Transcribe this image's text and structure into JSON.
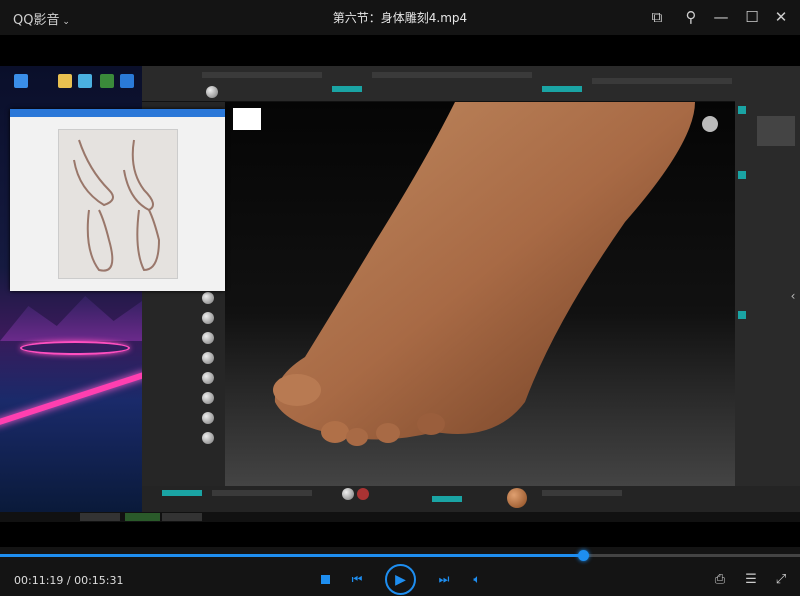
{
  "app": {
    "brand": "QQ影音",
    "brand_menu_icon": "chevron-down-icon",
    "title": "第六节：身体雕刻4.mp4"
  },
  "window_buttons": [
    {
      "name": "mini-mode",
      "icon": "picture-in-picture-icon",
      "glyph": "⧉"
    },
    {
      "name": "pin",
      "icon": "pin-icon",
      "glyph": "⚲"
    },
    {
      "name": "minimize",
      "icon": "minimize-icon",
      "glyph": "—"
    },
    {
      "name": "maximize",
      "icon": "maximize-icon",
      "glyph": "☐"
    },
    {
      "name": "close",
      "icon": "close-icon",
      "glyph": "✕"
    }
  ],
  "playback": {
    "current": "00:11:19",
    "total": "00:15:31",
    "time_text": "00:11:19 / 00:15:31",
    "progress_percent": 72.9,
    "state": "paused"
  },
  "controls": {
    "stop": "stop-icon",
    "previous": "previous-icon",
    "play": "play-icon",
    "next": "next-icon",
    "volume": "volume-icon"
  },
  "right_controls": [
    {
      "name": "screenshot",
      "icon": "screenshot-icon",
      "glyph": "⎙"
    },
    {
      "name": "settings",
      "icon": "equalizer-icon",
      "glyph": "☰"
    },
    {
      "name": "fullscreen",
      "icon": "fullscreen-icon",
      "glyph": "⤢"
    }
  ],
  "side_panel_toggle": "‹",
  "colors": {
    "accent": "#1e8ef0",
    "titlebar": "#141414",
    "zbrush_accent": "#1aa4a4",
    "skin": "#a86a45"
  }
}
